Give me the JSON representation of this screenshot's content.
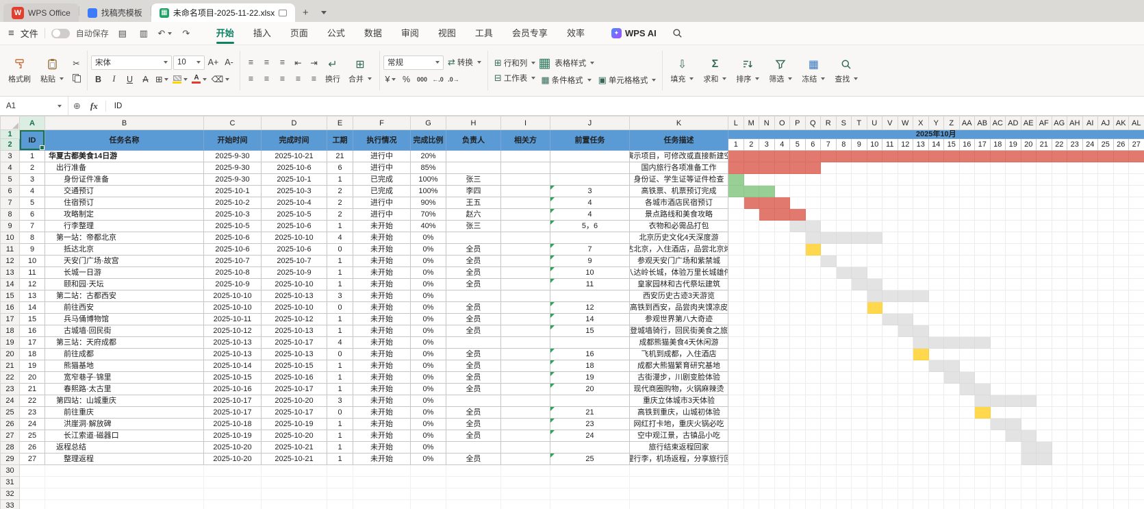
{
  "titlebar": {
    "home_tab": "WPS Office",
    "docer_tab": "找稿壳模板",
    "doc_tab": "未命名项目-2025-11-22.xlsx",
    "new_tab": "+"
  },
  "menubar": {
    "file": "文件",
    "autosave": "自动保存",
    "items": [
      "开始",
      "插入",
      "页面",
      "公式",
      "数据",
      "审阅",
      "视图",
      "工具",
      "会员专享",
      "效率"
    ],
    "active": "开始",
    "ai": "WPS AI"
  },
  "ribbon": {
    "format_painter": "格式刷",
    "paste": "粘贴",
    "font": "宋体",
    "size": "10",
    "wrap": "换行",
    "merge": "合并",
    "format": "常规",
    "convert": "转换",
    "rows_cols": "行和列",
    "worksheet": "工作表",
    "table_style": "表格样式",
    "cond_format": "条件格式",
    "cell_format": "单元格格式",
    "fill": "填充",
    "sum": "求和",
    "sort": "排序",
    "filter": "筛选",
    "freeze": "冻结",
    "find": "查找"
  },
  "icons": {
    "hamburger": "≡",
    "save": "▤",
    "print": "▥",
    "undo": "↶",
    "redo": "↷",
    "cut": "✂",
    "bold": "B",
    "italic": "I",
    "underline": "U",
    "strike": "A",
    "borders": "⊞",
    "clear": "⌫",
    "align": "≡",
    "indent_left": "⇤",
    "indent_right": "⇥",
    "wrap": "↵",
    "merge": "⊞",
    "convert": "⇄",
    "currency": "¥",
    "percent": "%",
    "thousands": "000",
    "dec_inc": "←.0",
    "dec_dec": ".0→",
    "rows_cols": "⊞",
    "worksheet": "⊟",
    "table_style": "▦",
    "cond_format": "▦",
    "cell_format": "▣",
    "fill": "⇩",
    "sum": "Σ",
    "freeze": "▦",
    "insert": "⊕",
    "font_up": "A+",
    "font_down": "A-",
    "plus": "+",
    "ai_spark": "✦"
  },
  "formula": {
    "name_box": "A1",
    "fx": "fx",
    "value": "ID"
  },
  "grid": {
    "table_headers": [
      "ID",
      "任务名称",
      "开始时间",
      "完成时间",
      "工期",
      "执行情况",
      "完成比例",
      "负责人",
      "相关方",
      "前置任务",
      "任务描述"
    ],
    "left_letters": [
      "A",
      "B",
      "C",
      "D",
      "E",
      "F",
      "G",
      "H",
      "I",
      "J",
      "K"
    ],
    "gantt_letters": [
      "L",
      "M",
      "N",
      "O",
      "P",
      "Q",
      "R",
      "S",
      "T",
      "U",
      "V",
      "W",
      "X",
      "Y",
      "Z",
      "AA",
      "AB",
      "AC",
      "AD",
      "AE",
      "AF",
      "AG",
      "AH",
      "AI",
      "AJ",
      "AK",
      "AL"
    ],
    "month": "2025年10月",
    "days": [
      1,
      2,
      3,
      4,
      5,
      6,
      7,
      8,
      9,
      10,
      11,
      12,
      13,
      14,
      15,
      16,
      17,
      18,
      19,
      20,
      21,
      22,
      23,
      24,
      25,
      26,
      27
    ]
  },
  "colors": {
    "header_blue": "#5b9bd5",
    "bar_red": "#e1796f",
    "bar_green": "#98cf94",
    "bar_yellow": "#ffd84d",
    "bar_gray": "#e3e3e3",
    "accent_green": "#0d8263",
    "selection_green": "#1d7145"
  },
  "tasks": [
    {
      "id": 1,
      "name": "华夏古都美食14日游",
      "indent": 0,
      "bold": true,
      "start": "2025-9-30",
      "end": "2025-10-21",
      "duration": "21",
      "status": "进行中",
      "percent": "20%",
      "owner": "",
      "pre": "",
      "desc": "生成的演示项目，可修改或直接新建空白项目",
      "bar": [
        1,
        27
      ],
      "bar_color": "red"
    },
    {
      "id": 2,
      "name": "出行准备",
      "indent": 1,
      "bold": false,
      "start": "2025-9-30",
      "end": "2025-10-6",
      "duration": "6",
      "status": "进行中",
      "percent": "85%",
      "owner": "",
      "pre": "",
      "desc": "国内旅行各项准备工作",
      "bar": [
        1,
        6
      ],
      "bar_color": "red"
    },
    {
      "id": 3,
      "name": "身份证件准备",
      "indent": 2,
      "bold": false,
      "start": "2025-9-30",
      "end": "2025-10-1",
      "duration": "1",
      "status": "已完成",
      "percent": "100%",
      "owner": "张三",
      "pre": "",
      "desc": "身份证、学生证等证件检查",
      "bar": [
        1,
        1
      ],
      "bar_color": "green"
    },
    {
      "id": 4,
      "name": "交通预订",
      "indent": 2,
      "bold": false,
      "start": "2025-10-1",
      "end": "2025-10-3",
      "duration": "2",
      "status": "已完成",
      "percent": "100%",
      "owner": "李四",
      "pre": "3",
      "desc": "高铁票、机票预订完成",
      "bar": [
        1,
        3
      ],
      "bar_color": "green"
    },
    {
      "id": 5,
      "name": "住宿预订",
      "indent": 2,
      "bold": false,
      "start": "2025-10-2",
      "end": "2025-10-4",
      "duration": "2",
      "status": "进行中",
      "percent": "90%",
      "owner": "王五",
      "pre": "4",
      "desc": "各城市酒店民宿预订",
      "bar": [
        2,
        4
      ],
      "bar_color": "red"
    },
    {
      "id": 6,
      "name": "攻略制定",
      "indent": 2,
      "bold": false,
      "start": "2025-10-3",
      "end": "2025-10-5",
      "duration": "2",
      "status": "进行中",
      "percent": "70%",
      "owner": "赵六",
      "pre": "4",
      "desc": "景点路线和美食攻略",
      "bar": [
        3,
        5
      ],
      "bar_color": "red"
    },
    {
      "id": 7,
      "name": "行李整理",
      "indent": 2,
      "bold": false,
      "start": "2025-10-5",
      "end": "2025-10-6",
      "duration": "1",
      "status": "未开始",
      "percent": "40%",
      "owner": "张三",
      "pre": "5，6",
      "desc": "衣物和必需品打包",
      "bar": [
        5,
        6
      ],
      "bar_color": "gray"
    },
    {
      "id": 8,
      "name": "第一站：帝都北京",
      "indent": 1,
      "bold": false,
      "start": "2025-10-6",
      "end": "2025-10-10",
      "duration": "4",
      "status": "未开始",
      "percent": "0%",
      "owner": "",
      "pre": "",
      "desc": "北京历史文化4天深度游",
      "bar": [
        6,
        10
      ],
      "bar_color": "gray"
    },
    {
      "id": 9,
      "name": "抵达北京",
      "indent": 2,
      "bold": false,
      "start": "2025-10-6",
      "end": "2025-10-6",
      "duration": "0",
      "status": "未开始",
      "percent": "0%",
      "owner": "全员",
      "pre": "7",
      "desc": "抵达北京，入住酒店，品尝北京烤鸭",
      "bar": [
        6,
        6
      ],
      "bar_color": "yellow"
    },
    {
      "id": 10,
      "name": "天安门广场·故宫",
      "indent": 2,
      "bold": false,
      "start": "2025-10-7",
      "end": "2025-10-7",
      "duration": "1",
      "status": "未开始",
      "percent": "0%",
      "owner": "全员",
      "pre": "9",
      "desc": "参观天安门广场和紫禁城",
      "bar": [
        7,
        7
      ],
      "bar_color": "gray"
    },
    {
      "id": 11,
      "name": "长城一日游",
      "indent": 2,
      "bold": false,
      "start": "2025-10-8",
      "end": "2025-10-9",
      "duration": "1",
      "status": "未开始",
      "percent": "0%",
      "owner": "全员",
      "pre": "10",
      "desc": "八达岭长城，体验万里长城雄伟",
      "bar": [
        8,
        9
      ],
      "bar_color": "gray"
    },
    {
      "id": 12,
      "name": "颐和园·天坛",
      "indent": 2,
      "bold": false,
      "start": "2025-10-9",
      "end": "2025-10-10",
      "duration": "1",
      "status": "未开始",
      "percent": "0%",
      "owner": "全员",
      "pre": "11",
      "desc": "皇家园林和古代祭坛建筑",
      "bar": [
        9,
        10
      ],
      "bar_color": "gray"
    },
    {
      "id": 13,
      "name": "第二站：古都西安",
      "indent": 1,
      "bold": false,
      "start": "2025-10-10",
      "end": "2025-10-13",
      "duration": "3",
      "status": "未开始",
      "percent": "0%",
      "owner": "",
      "pre": "",
      "desc": "西安历史古迹3天游览",
      "bar": [
        10,
        13
      ],
      "bar_color": "gray"
    },
    {
      "id": 14,
      "name": "前往西安",
      "indent": 2,
      "bold": false,
      "start": "2025-10-10",
      "end": "2025-10-10",
      "duration": "0",
      "status": "未开始",
      "percent": "0%",
      "owner": "全员",
      "pre": "12",
      "desc": "高铁到西安，品尝肉夹馍凉皮",
      "bar": [
        10,
        10
      ],
      "bar_color": "yellow"
    },
    {
      "id": 15,
      "name": "兵马俑博物馆",
      "indent": 2,
      "bold": false,
      "start": "2025-10-11",
      "end": "2025-10-12",
      "duration": "1",
      "status": "未开始",
      "percent": "0%",
      "owner": "全员",
      "pre": "14",
      "desc": "参观世界第八大奇迹",
      "bar": [
        11,
        12
      ],
      "bar_color": "gray"
    },
    {
      "id": 16,
      "name": "古城墙·回民街",
      "indent": 2,
      "bold": false,
      "start": "2025-10-12",
      "end": "2025-10-13",
      "duration": "1",
      "status": "未开始",
      "percent": "0%",
      "owner": "全员",
      "pre": "15",
      "desc": "登城墙骑行，回民街美食之旅",
      "bar": [
        12,
        13
      ],
      "bar_color": "gray"
    },
    {
      "id": 17,
      "name": "第三站：天府成都",
      "indent": 1,
      "bold": false,
      "start": "2025-10-13",
      "end": "2025-10-17",
      "duration": "4",
      "status": "未开始",
      "percent": "0%",
      "owner": "",
      "pre": "",
      "desc": "成都熊猫美食4天休闲游",
      "bar": [
        13,
        17
      ],
      "bar_color": "gray"
    },
    {
      "id": 18,
      "name": "前往成都",
      "indent": 2,
      "bold": false,
      "start": "2025-10-13",
      "end": "2025-10-13",
      "duration": "0",
      "status": "未开始",
      "percent": "0%",
      "owner": "全员",
      "pre": "16",
      "desc": "飞机到成都，入住酒店",
      "bar": [
        13,
        13
      ],
      "bar_color": "yellow"
    },
    {
      "id": 19,
      "name": "熊猫基地",
      "indent": 2,
      "bold": false,
      "start": "2025-10-14",
      "end": "2025-10-15",
      "duration": "1",
      "status": "未开始",
      "percent": "0%",
      "owner": "全员",
      "pre": "18",
      "desc": "成都大熊猫繁育研究基地",
      "bar": [
        14,
        15
      ],
      "bar_color": "gray"
    },
    {
      "id": 20,
      "name": "宽窄巷子·锦里",
      "indent": 2,
      "bold": false,
      "start": "2025-10-15",
      "end": "2025-10-16",
      "duration": "1",
      "status": "未开始",
      "percent": "0%",
      "owner": "全员",
      "pre": "19",
      "desc": "古街漫步，川剧变脸体验",
      "bar": [
        15,
        16
      ],
      "bar_color": "gray"
    },
    {
      "id": 21,
      "name": "春熙路·太古里",
      "indent": 2,
      "bold": false,
      "start": "2025-10-16",
      "end": "2025-10-17",
      "duration": "1",
      "status": "未开始",
      "percent": "0%",
      "owner": "全员",
      "pre": "20",
      "desc": "现代商圈购物，火锅麻辣烫",
      "bar": [
        16,
        17
      ],
      "bar_color": "gray"
    },
    {
      "id": 22,
      "name": "第四站：山城重庆",
      "indent": 1,
      "bold": false,
      "start": "2025-10-17",
      "end": "2025-10-20",
      "duration": "3",
      "status": "未开始",
      "percent": "0%",
      "owner": "",
      "pre": "",
      "desc": "重庆立体城市3天体验",
      "bar": [
        17,
        20
      ],
      "bar_color": "gray"
    },
    {
      "id": 23,
      "name": "前往重庆",
      "indent": 2,
      "bold": false,
      "start": "2025-10-17",
      "end": "2025-10-17",
      "duration": "0",
      "status": "未开始",
      "percent": "0%",
      "owner": "全员",
      "pre": "21",
      "desc": "高铁到重庆，山城初体验",
      "bar": [
        17,
        17
      ],
      "bar_color": "yellow"
    },
    {
      "id": 24,
      "name": "洪崖洞·解放碑",
      "indent": 2,
      "bold": false,
      "start": "2025-10-18",
      "end": "2025-10-19",
      "duration": "1",
      "status": "未开始",
      "percent": "0%",
      "owner": "全员",
      "pre": "23",
      "desc": "网红打卡地，重庆火锅必吃",
      "bar": [
        18,
        19
      ],
      "bar_color": "gray"
    },
    {
      "id": 25,
      "name": "长江索道·磁器口",
      "indent": 2,
      "bold": false,
      "start": "2025-10-19",
      "end": "2025-10-20",
      "duration": "1",
      "status": "未开始",
      "percent": "0%",
      "owner": "全员",
      "pre": "24",
      "desc": "空中观江景，古镇品小吃",
      "bar": [
        19,
        20
      ],
      "bar_color": "gray"
    },
    {
      "id": 26,
      "name": "返程总结",
      "indent": 1,
      "bold": false,
      "start": "2025-10-20",
      "end": "2025-10-21",
      "duration": "1",
      "status": "未开始",
      "percent": "0%",
      "owner": "",
      "pre": "",
      "desc": "旅行结束返程回家",
      "bar": [
        20,
        21
      ],
      "bar_color": "gray"
    },
    {
      "id": 27,
      "name": "整理返程",
      "indent": 2,
      "bold": false,
      "start": "2025-10-20",
      "end": "2025-10-21",
      "duration": "1",
      "status": "未开始",
      "percent": "0%",
      "owner": "全员",
      "pre": "25",
      "desc": "整理行李，机场返程，分享旅行回忆",
      "bar": [
        20,
        21
      ],
      "bar_color": "gray"
    }
  ]
}
